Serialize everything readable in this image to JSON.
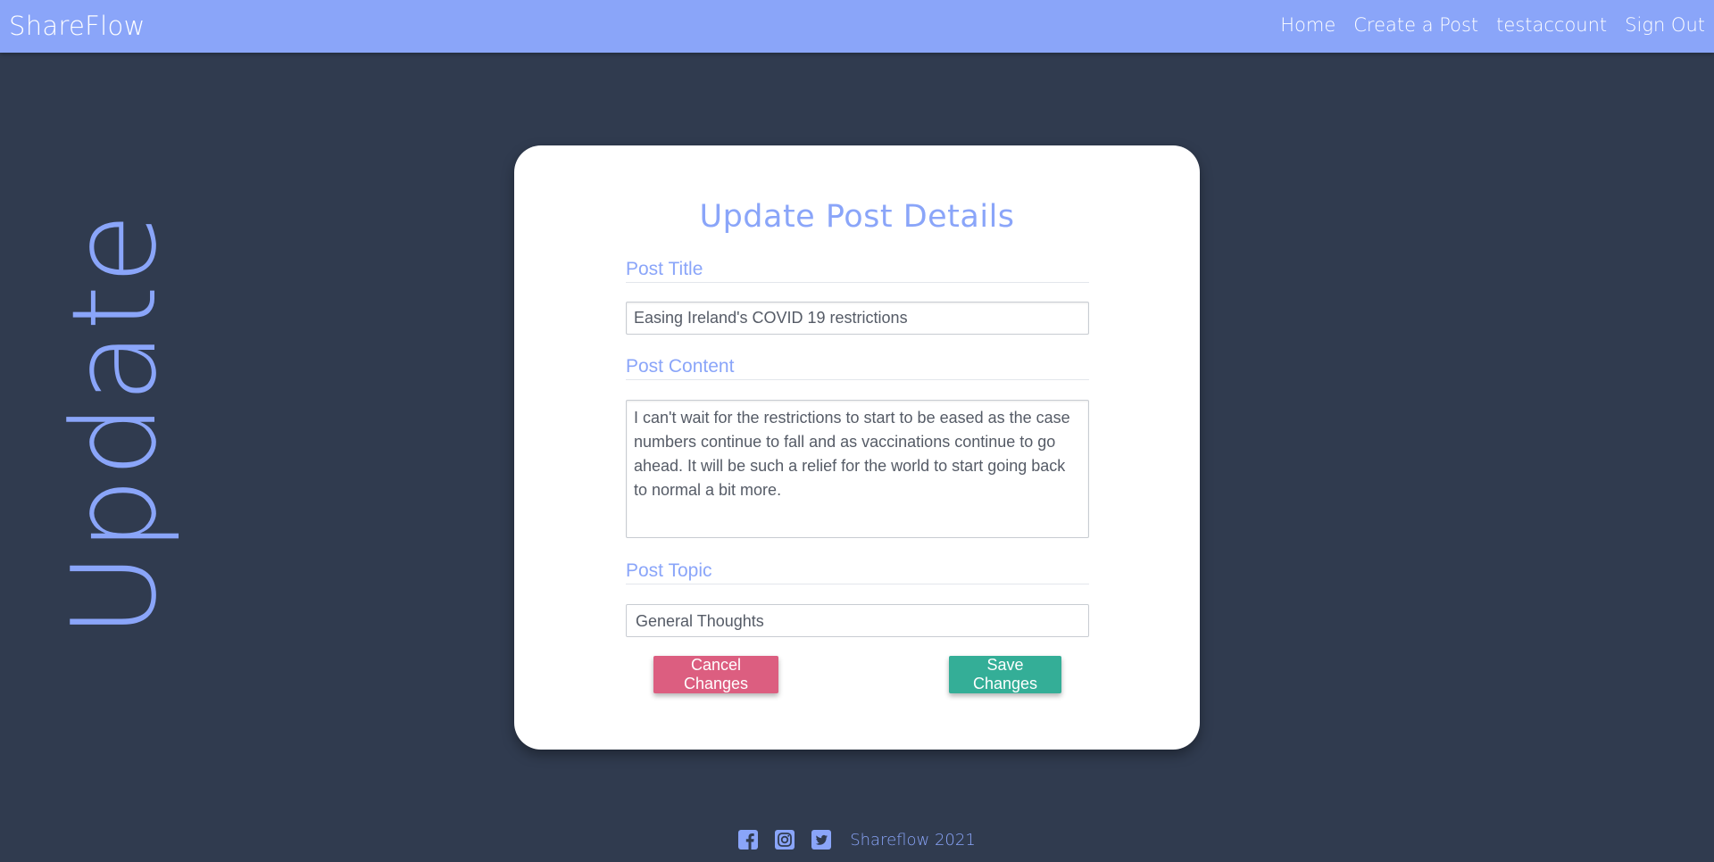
{
  "navbar": {
    "brand": "ShareFlow",
    "links": [
      "Home",
      "Create a Post",
      "testaccount",
      "Sign Out"
    ]
  },
  "side_heading": "Update",
  "form": {
    "title": "Update Post Details",
    "post_title": {
      "label": "Post Title",
      "value": "Easing Ireland's COVID 19 restrictions"
    },
    "post_content": {
      "label": "Post Content",
      "value": "I can't wait for the restrictions to start to be eased as the case numbers continue to fall and as vaccinations continue to go ahead. It will be such a relief for the world to start going back to normal a bit more."
    },
    "post_topic": {
      "label": "Post Topic",
      "value": "General Thoughts"
    },
    "cancel_label": "Cancel Changes",
    "save_label": "Save Changes"
  },
  "footer": {
    "icons": [
      "facebook-icon",
      "instagram-icon",
      "twitter-icon"
    ],
    "text": "Shareflow 2021"
  },
  "colors": {
    "background": "#303b4f",
    "accent": "#8aa5f9",
    "cancel": "#dc5e80",
    "save": "#34ae97"
  }
}
